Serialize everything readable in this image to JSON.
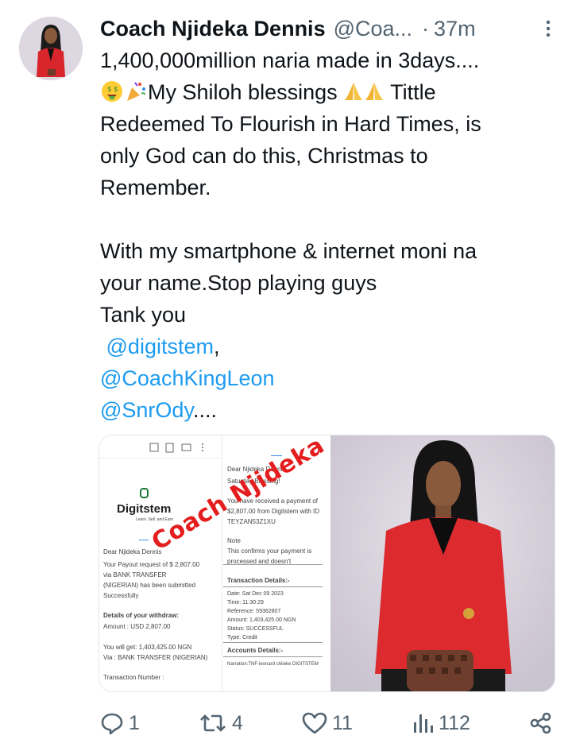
{
  "tweet": {
    "author_name": "Coach Njideka Dennis",
    "handle": "@Coa...",
    "separator": "·",
    "time": "37m",
    "lines": [
      "1,400,000million naria made in 3days....",
      "My Shiloh blessings",
      "Tittle",
      "Redeemed To Flourish in Hard Times, is",
      "only God can do this, Christmas to",
      "Remember.",
      "",
      "With my smartphone & internet moni na",
      "your name.Stop playing guys",
      "Tank you"
    ],
    "mentions": [
      "@digitstem",
      ",",
      "@CoachKingLeon",
      "@SnrOdy",
      "...."
    ]
  },
  "media": {
    "left_screenshot": {
      "brand": "Digitstem",
      "tagline": "Learn. Sell. and Earn",
      "greeting": "Dear Njideka Dennis",
      "payout_line1": "Your Payout request of $ 2,807.00",
      "payout_line2": "via  BANK TRANSFER",
      "payout_line3": "(NIGERIAN) has been submitted",
      "payout_line4": "Successfully",
      "details_title": "Details of your withdraw:",
      "amount": "Amount : USD 2,807.00",
      "you_get": "You will get: 1,403,425.00 NGN",
      "via": "Via : BANK TRANSFER (NIGERIAN)",
      "txn_number": "Transaction Number :"
    },
    "right_screenshot": {
      "greeting": "Dear Njideka Dennis",
      "subtitle": "Saturday Blessing!",
      "received1": "You have received a payment of",
      "received2": "$2,807.00 from Digitstem with ID",
      "received3": "TEYZAN53Z1XU",
      "note": "Note",
      "confirms": "This confirms your payment is",
      "confirms2": "processed and doesn't",
      "txn_title": "Transaction Details:-",
      "date": "Date: Sat Dec 09 2023",
      "time": "Time: 11:30:29",
      "reference": "Reference: 59362807",
      "amount": "Amount: 1,403,425.00 NGN",
      "status": "Status: SUCCESSFUL",
      "type": "Type: Credit",
      "accounts_title": "Accounts Details:-",
      "narration": "Narration:TNF-leonard chiieke DIGITSTEM"
    },
    "watermark": "Coach Njideka"
  },
  "actions": {
    "replies": "1",
    "retweets": "4",
    "likes": "11",
    "views": "112"
  },
  "colors": {
    "link": "#1d9bf0",
    "muted": "#536471",
    "text": "#0f1419",
    "watermark": "#e41e1e"
  },
  "icons": [
    "more-icon",
    "reply-icon",
    "retweet-icon",
    "like-icon",
    "views-icon",
    "share-icon"
  ]
}
